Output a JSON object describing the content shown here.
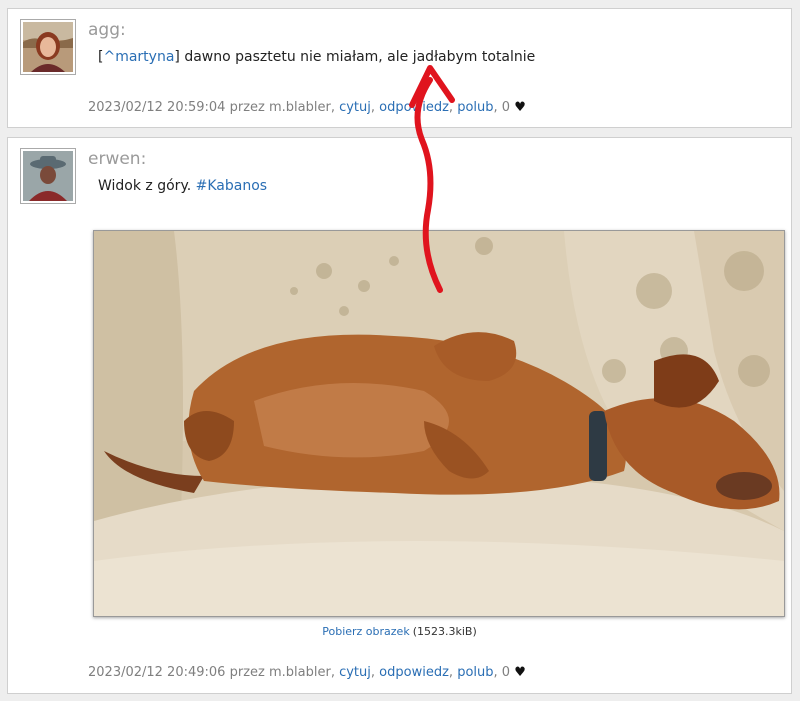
{
  "posts": [
    {
      "author": "agg:",
      "mention_open": "[",
      "mention": "^martyna",
      "mention_close": "]",
      "text": " dawno pasztetu nie miałam, ale jadłabym totalnie",
      "meta": {
        "timestamp": "2023/02/12 20:59:04",
        "by_prefix": "przez",
        "by_user": "m.blabler,",
        "quote": "cytuj",
        "reply": "odpowiedz",
        "like": "polub",
        "likes_count": ", 0",
        "sep": ","
      }
    },
    {
      "author": "erwen:",
      "text": "Widok z góry. ",
      "hashtag": "#Kabanos",
      "image": {
        "download_label": "Pobierz obrazek",
        "size": "(1523.3kiB)"
      },
      "meta": {
        "timestamp": "2023/02/12 20:49:06",
        "by_prefix": "przez",
        "by_user": "m.blabler,",
        "quote": "cytuj",
        "reply": "odpowiedz",
        "like": "polub",
        "likes_count": ", 0",
        "sep": ","
      }
    }
  ],
  "icons": {
    "heart": "♥",
    "annotation": "red-arrow-icon"
  },
  "colors": {
    "link": "#2a6eb4",
    "author": "#9a9a9a",
    "meta": "#7f7f7f",
    "annotation": "#e0141e"
  }
}
